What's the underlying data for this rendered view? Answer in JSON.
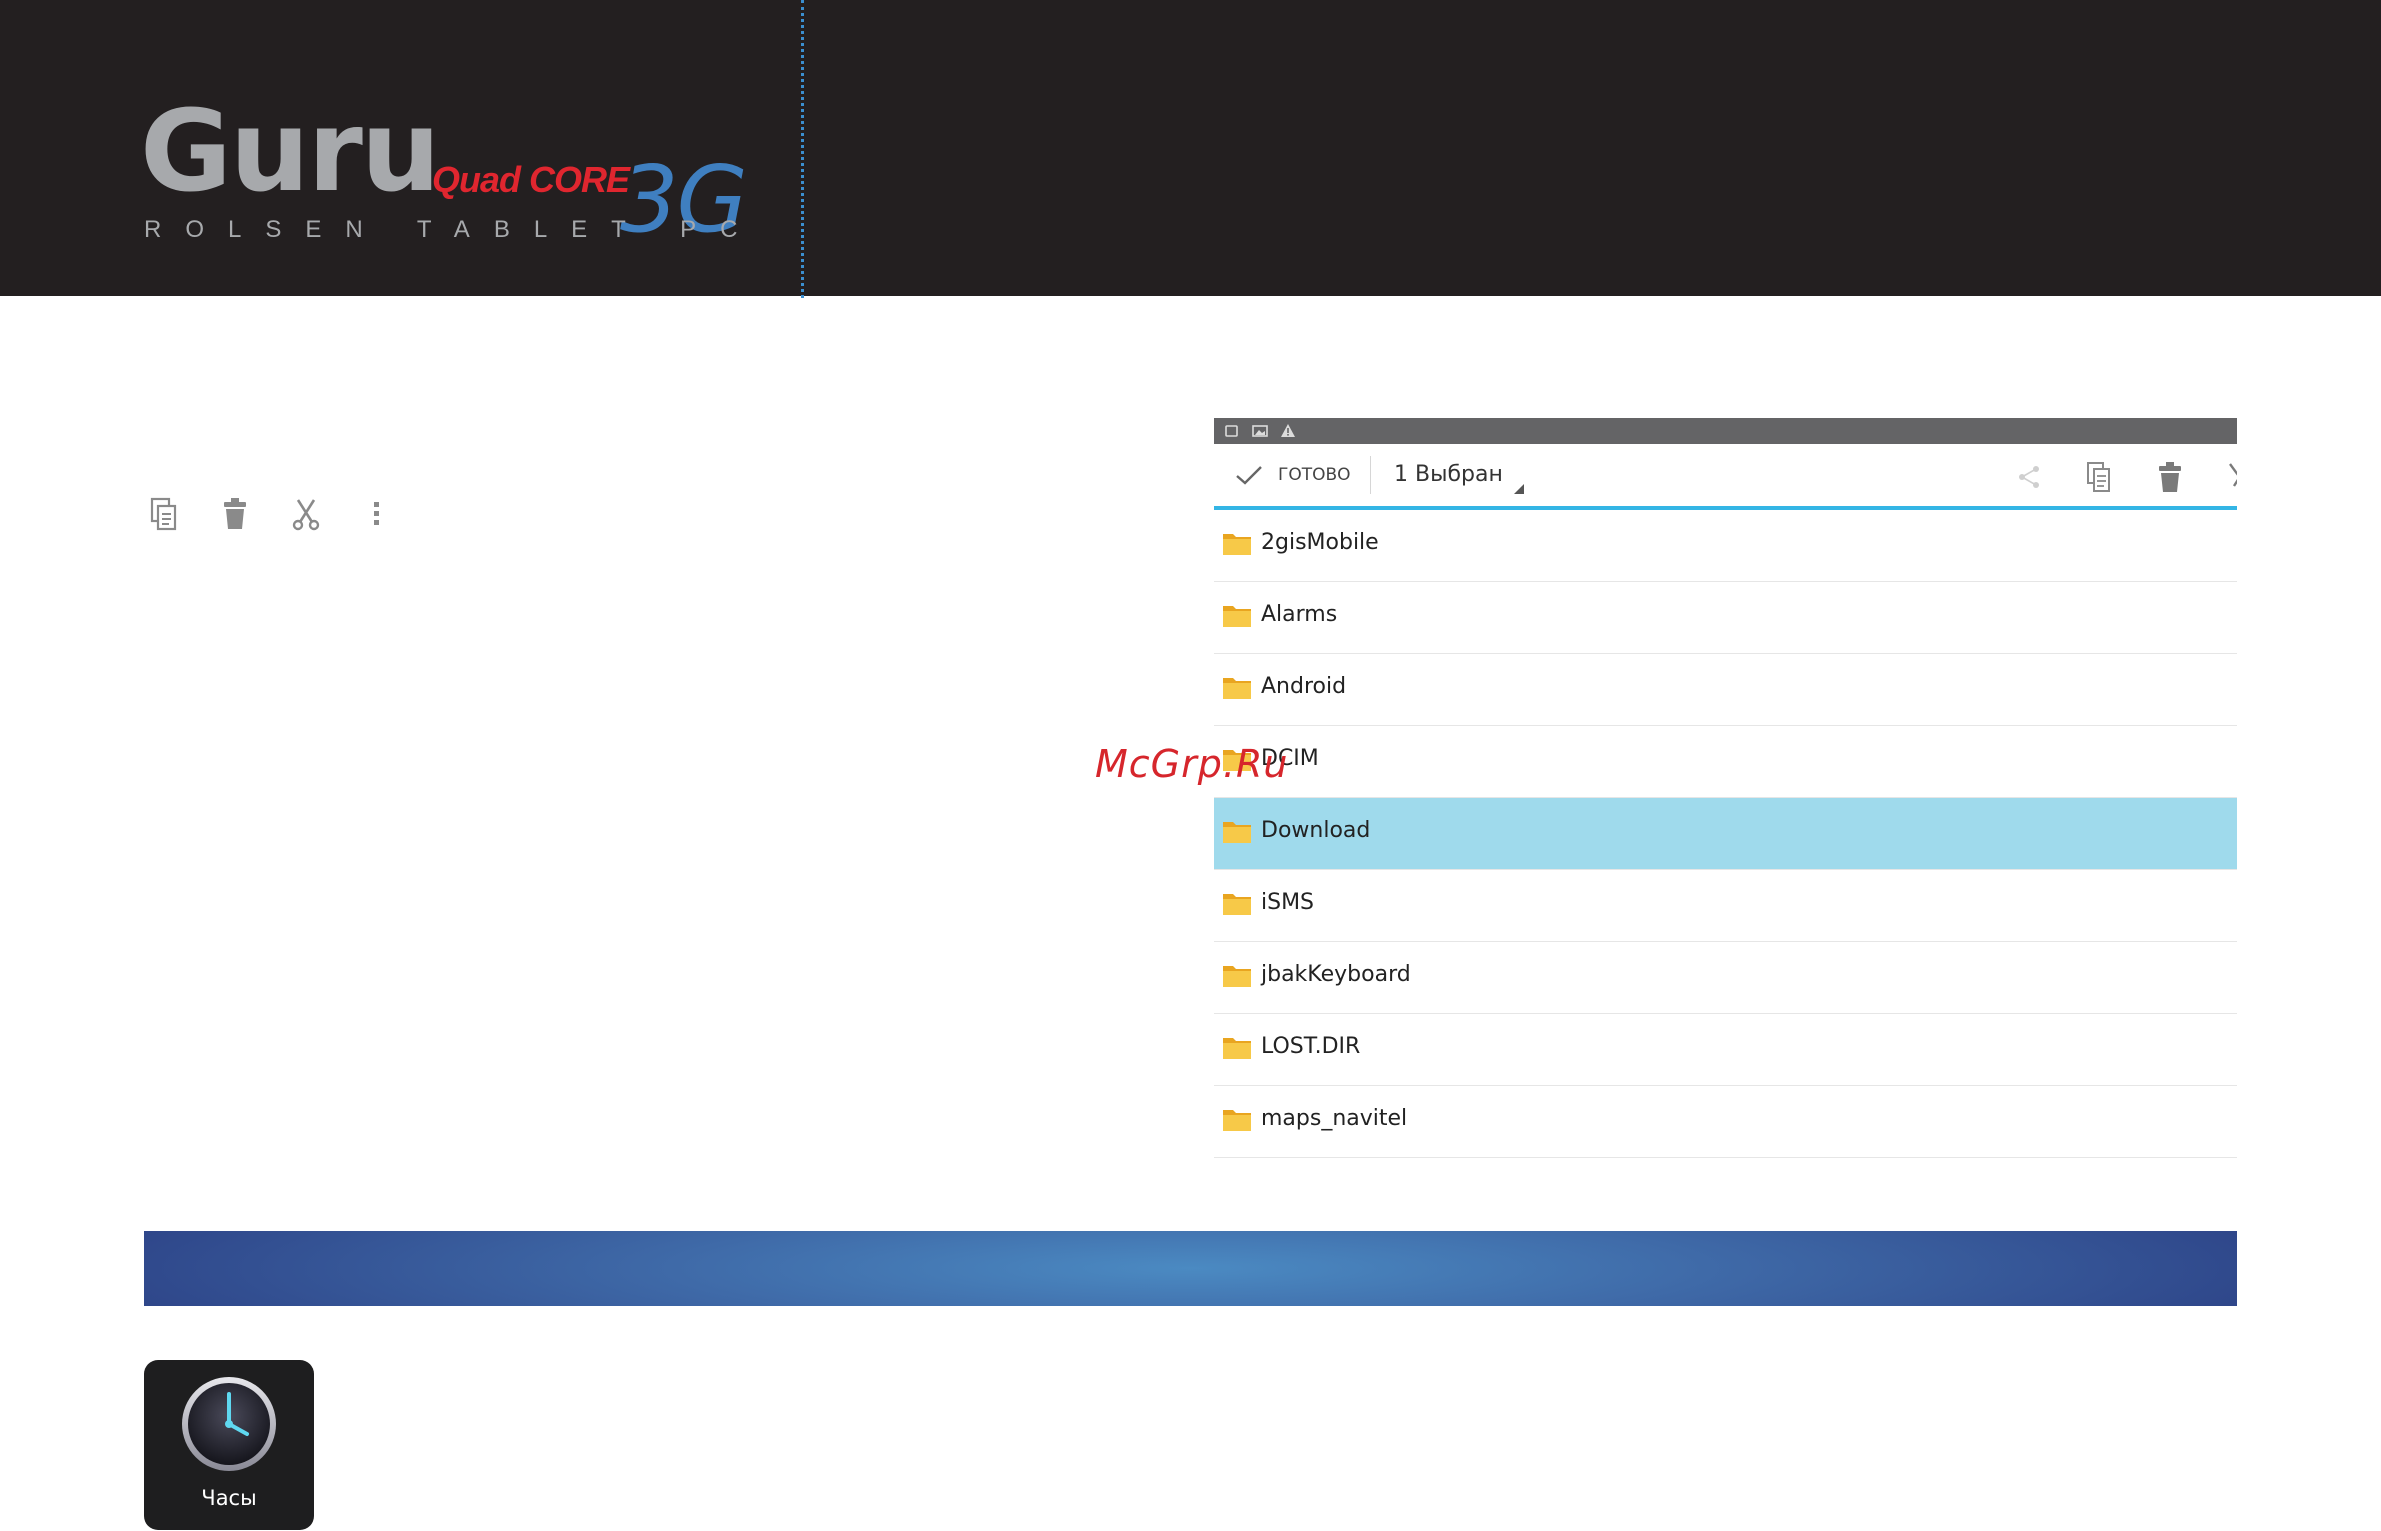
{
  "header": {
    "brand": "Guru",
    "tagline_quad": "Quad CORE",
    "tagline_3g": "3G",
    "subtitle": "ROLSEN TABLET PC"
  },
  "left_actions": [
    "copy-icon",
    "trash-icon",
    "scissors-icon",
    "overflow-menu-icon"
  ],
  "file_manager": {
    "status_icons": [
      "screenshot-icon",
      "gallery-icon",
      "warning-icon"
    ],
    "done_label": "ГОТОВО",
    "selected_count_label": "1 Выбран",
    "toolbar_icons": [
      "share-icon",
      "copy-icon",
      "trash-icon",
      "scissors-icon"
    ],
    "accent_color": "#33b5e5",
    "selected_row_color": "#9fdaec",
    "folders": [
      {
        "name": "2gisMobile",
        "selected": false
      },
      {
        "name": "Alarms",
        "selected": false
      },
      {
        "name": "Android",
        "selected": false
      },
      {
        "name": "DCIM",
        "selected": false
      },
      {
        "name": "Download",
        "selected": true
      },
      {
        "name": "iSMS",
        "selected": false
      },
      {
        "name": "jbakKeyboard",
        "selected": false
      },
      {
        "name": "LOST.DIR",
        "selected": false
      },
      {
        "name": "maps_navitel",
        "selected": false
      }
    ]
  },
  "watermark": "McGrp.Ru",
  "app_icon": {
    "label": "Часы",
    "icon": "clock-icon"
  },
  "colors": {
    "header_bg": "#231f20",
    "logo_gray": "#a7a9ac",
    "logo_red": "#e0262f",
    "logo_blue": "#3f7fc0",
    "band_center": "#4b8ac2",
    "band_edge": "#2d4387"
  }
}
